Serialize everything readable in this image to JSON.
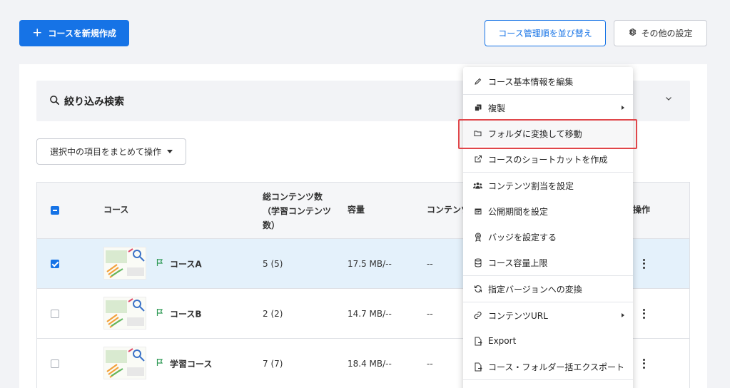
{
  "toolbar": {
    "new_course_label": "コースを新規作成",
    "sort_label": "コース管理順を並び替え",
    "other_settings_label": "その他の設定"
  },
  "filter": {
    "title": "絞り込み検索"
  },
  "bulk": {
    "label": "選択中の項目をまとめて操作"
  },
  "table": {
    "headers": {
      "course": "コース",
      "total_contents": "総コンテンツ数",
      "total_contents_sub1": "（学習コンテンツ",
      "total_contents_sub2": "数）",
      "capacity": "容量",
      "contents": "コンテンツ",
      "actions": "操作"
    },
    "rows": [
      {
        "name": "コースA",
        "count": "5 (5)",
        "size": "17.5 MB/--",
        "contents": "--",
        "checked": true
      },
      {
        "name": "コースB",
        "count": "2 (2)",
        "size": "14.7 MB/--",
        "contents": "--",
        "checked": false
      },
      {
        "name": "学習コース",
        "count": "7 (7)",
        "size": "18.4 MB/--",
        "contents": "--",
        "checked": false
      }
    ]
  },
  "menu": {
    "items": [
      {
        "label": "コース基本情報を編集",
        "icon": "pencil-icon"
      },
      {
        "label": "複製",
        "icon": "copy-icon"
      },
      {
        "label": "フォルダに変換して移動",
        "icon": "folder-icon"
      },
      {
        "label": "コースのショートカットを作成",
        "icon": "external-link-icon"
      },
      {
        "label": "コンテンツ割当を設定",
        "icon": "users-icon"
      },
      {
        "label": "公開期間を設定",
        "icon": "calendar-icon"
      },
      {
        "label": "バッジを設定する",
        "icon": "badge-icon"
      },
      {
        "label": "コース容量上限",
        "icon": "database-icon"
      },
      {
        "label": "指定バージョンへの変換",
        "icon": "refresh-icon"
      },
      {
        "label": "コンテンツURL",
        "icon": "link-icon"
      },
      {
        "label": "Export",
        "icon": "export-icon"
      },
      {
        "label": "コース・フォルダー括エクスポート",
        "icon": "export-icon"
      }
    ]
  },
  "colors": {
    "primary": "#1673e6",
    "highlight": "#e0464a",
    "selected_row": "#e4f1fb"
  }
}
